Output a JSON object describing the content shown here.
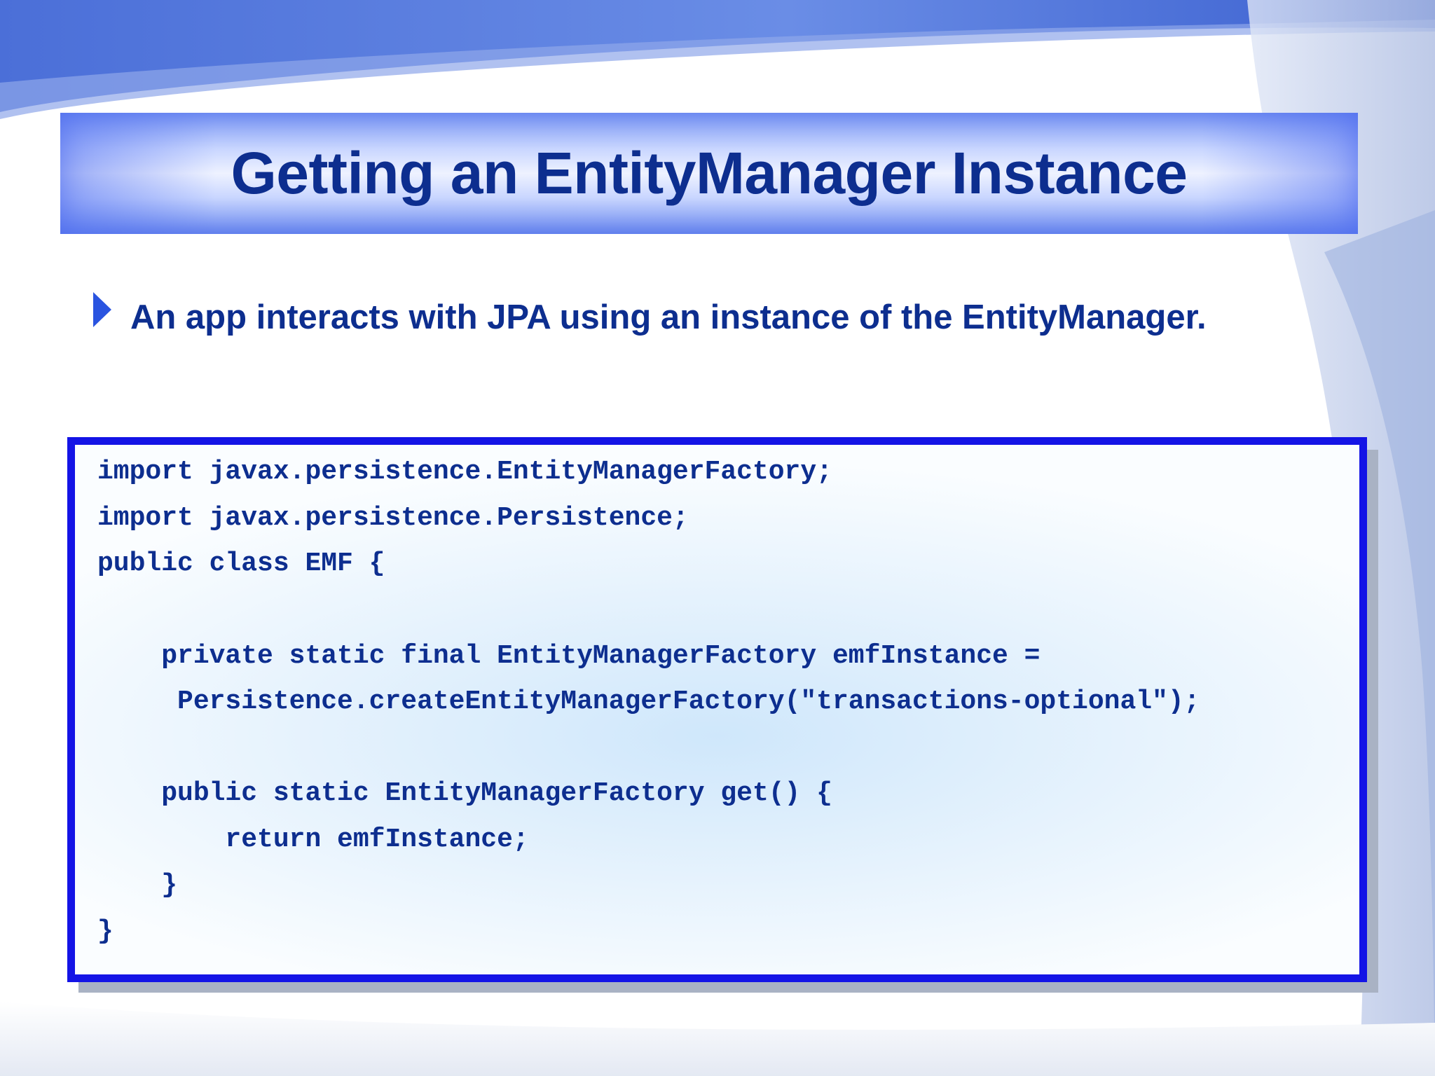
{
  "slide": {
    "title": "Getting an EntityManager Instance",
    "bullet": "An app interacts with JPA using an instance of the EntityManager.",
    "code_lines": [
      "import javax.persistence.EntityManagerFactory;",
      "import javax.persistence.Persistence;",
      "public class EMF {",
      "",
      "    private static final EntityManagerFactory emfInstance =",
      "     Persistence.createEntityManagerFactory(\"transactions-optional\");",
      "",
      "    public static EntityManagerFactory get() {",
      "        return emfInstance;",
      "    }",
      "}"
    ]
  },
  "colors": {
    "title_text": "#0d2e8f",
    "bullet_text": "#0d2e8f",
    "code_text": "#0d2e8f",
    "code_border": "#1414e6",
    "bullet_marker": "#2a54e0"
  },
  "icons": {
    "bullet": "triangle-right-icon"
  }
}
